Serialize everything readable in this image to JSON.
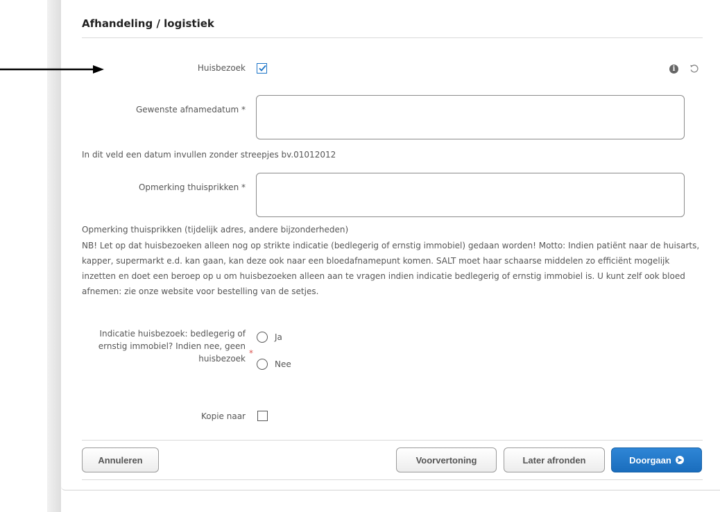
{
  "section_title": "Afhandeling / logistiek",
  "fields": {
    "huisbezoek": {
      "label": "Huisbezoek",
      "checked": true
    },
    "afnamedatum": {
      "label": "Gewenste afnamedatum *",
      "value": "",
      "help": "In dit veld een datum invullen zonder streepjes bv.01012012"
    },
    "opmerking": {
      "label": "Opmerking thuisprikken *",
      "value": "",
      "help": "Opmerking thuisprikken (tijdelijk adres, andere bijzonderheden)"
    },
    "notice": "NB! Let op dat huisbezoeken alleen nog op strikte indicatie (bedlegerig of ernstig immobiel) gedaan worden! Motto: Indien patiënt naar de huisarts, kapper, supermarkt e.d. kan gaan, kan deze ook naar een bloedafnamepunt komen. SALT moet haar schaarse middelen zo efficiënt mogelijk inzetten en doet een beroep op u om huisbezoeken alleen aan te vragen indien indicatie bedlegerig of ernstig immobiel is. U kunt zelf ook bloed afnemen: zie onze website voor bestelling van de setjes.",
    "indicatie": {
      "label": "Indicatie huisbezoek: bedlegerig of ernstig immobiel? Indien nee, geen huisbezoek",
      "required_marker": "*",
      "options": [
        "Ja",
        "Nee"
      ],
      "selected": null
    },
    "kopie": {
      "label": "Kopie naar",
      "checked": false
    }
  },
  "icons": {
    "info": "info-icon",
    "reset": "reset-icon"
  },
  "info_glyph": "i",
  "buttons": {
    "cancel": "Annuleren",
    "preview": "Voorvertoning",
    "later": "Later afronden",
    "continue": "Doorgaan"
  },
  "colors": {
    "accent": "#1a73c7",
    "primary_button": "#1a6dbd",
    "required": "#d9534f"
  }
}
